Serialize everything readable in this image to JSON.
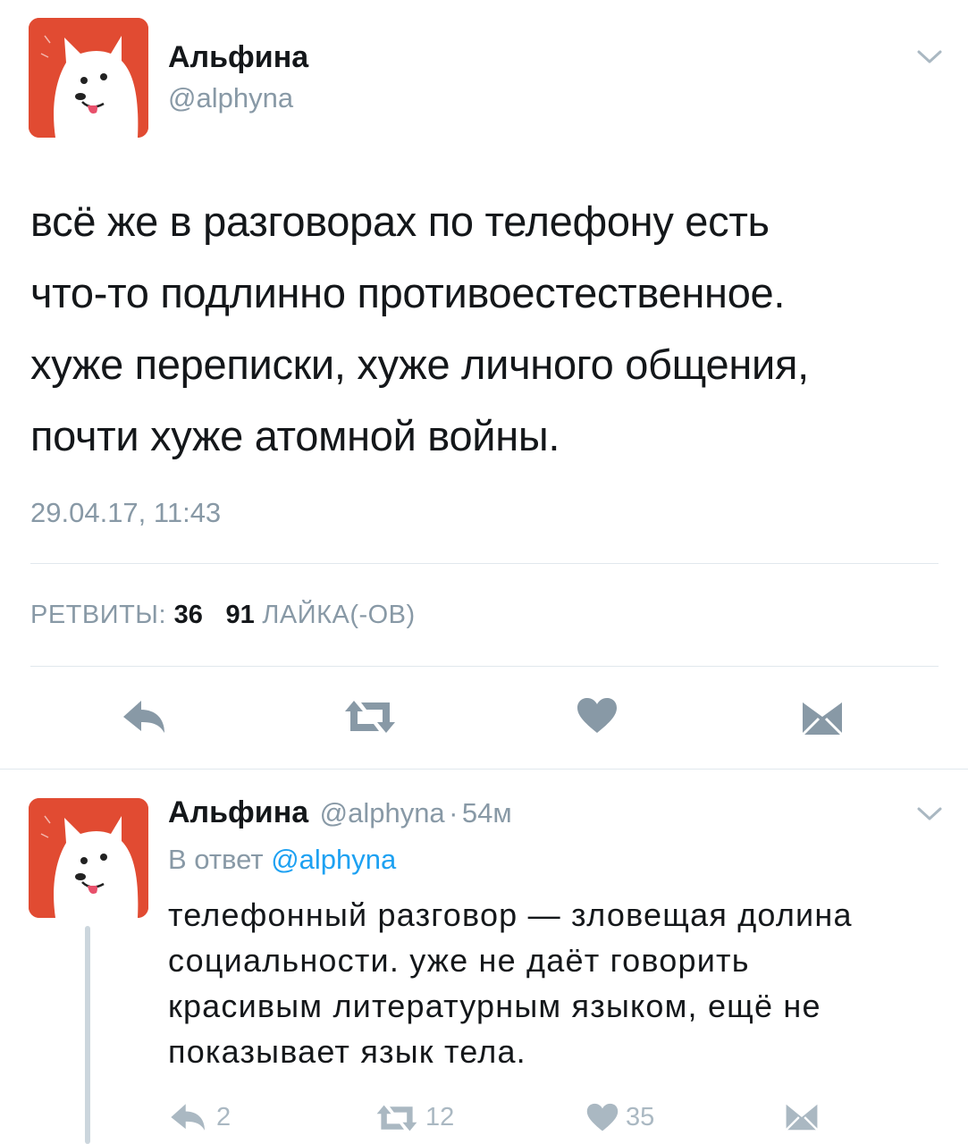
{
  "tweet": {
    "author_name": "Альфина",
    "author_handle": "@alphyna",
    "text_lines": [
      "всё же в разговорах по телефону есть",
      "что-то подлинно противоестественное.",
      "хуже переписки, хуже личного общения,",
      "почти хуже атомной войны."
    ],
    "timestamp": "29.04.17, 11:43",
    "retweets_label": "РЕТВИТЫ:",
    "retweets_count": "36",
    "likes_count": "91",
    "likes_label": "ЛАЙКА(-ОВ)",
    "actions": [
      "reply-icon",
      "retweet-icon",
      "heart-icon",
      "message-icon"
    ]
  },
  "reply": {
    "author_name": "Альфина",
    "author_handle": "@alphyna",
    "separator": "·",
    "time_ago": "54м",
    "in_reply_prefix": "В ответ",
    "in_reply_handle": "@alphyna",
    "text_lines": [
      "телефонный разговор — зловещая долина",
      "социальности. уже не даёт говорить",
      "красивым литературным языком, ещё не",
      "показывает язык тела."
    ],
    "reply_count": "2",
    "retweet_count": "12",
    "like_count": "35"
  },
  "colors": {
    "avatar_bg": "#e14b32",
    "link": "#1da1f2",
    "secondary_text": "#8899a6",
    "icon": "#8899a6",
    "divider": "#e1e8ed"
  }
}
